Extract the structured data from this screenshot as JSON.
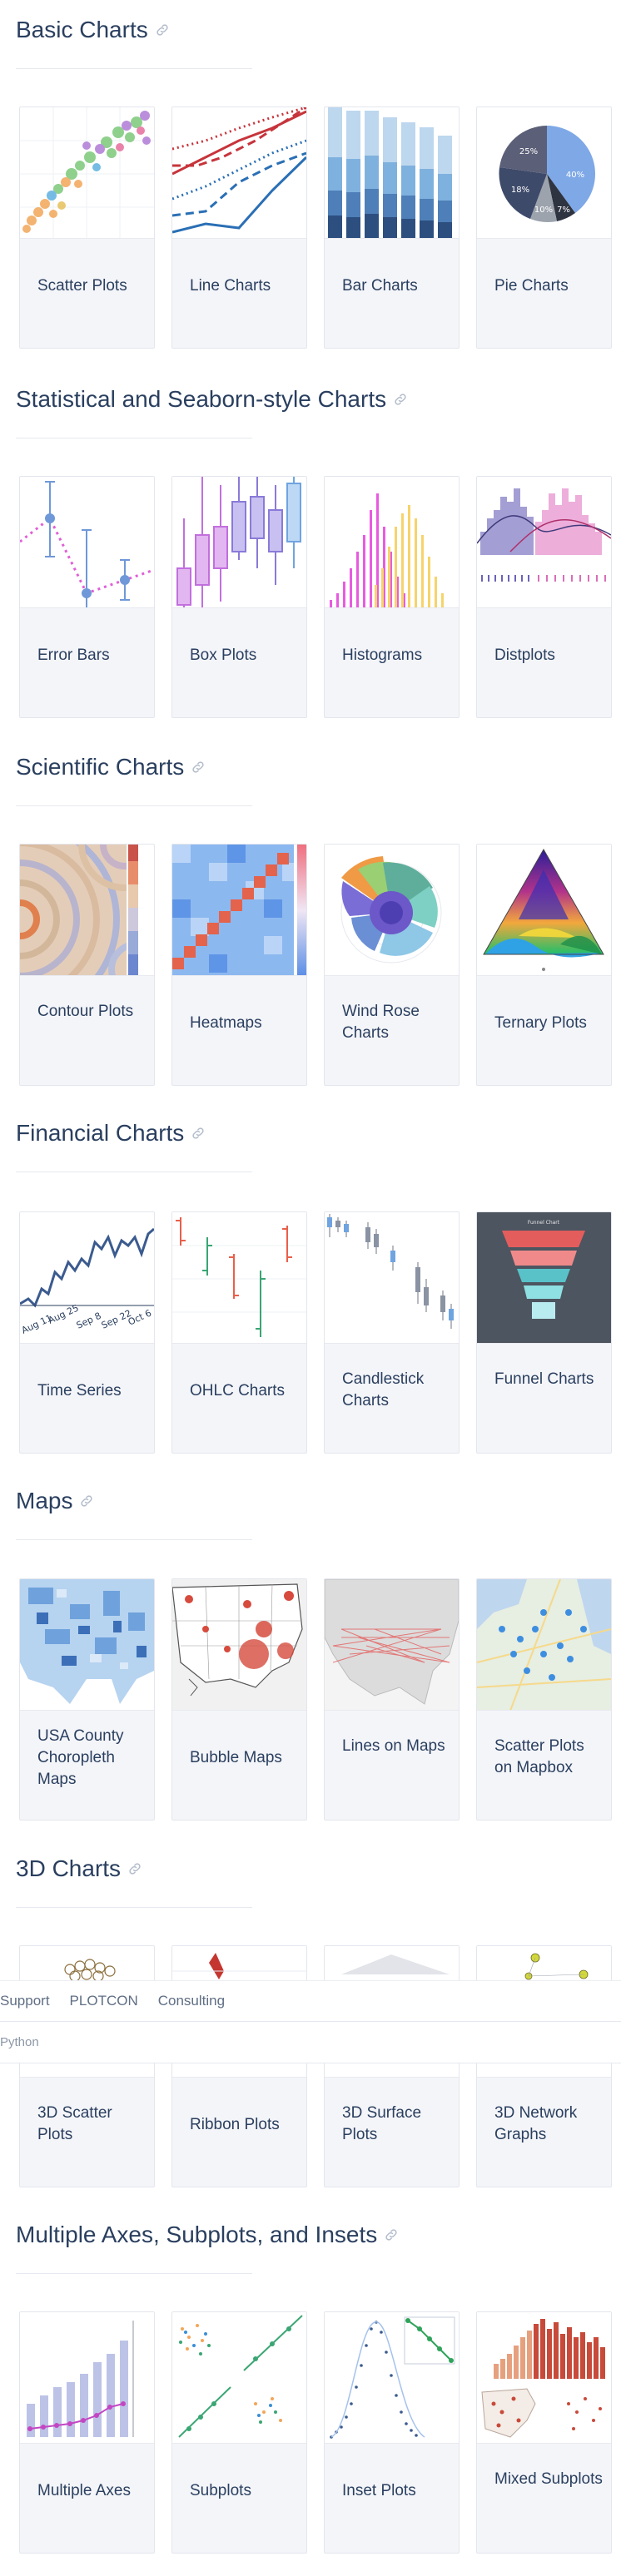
{
  "colors": {
    "text": "#2a3f5f",
    "card_bg": "#f4f5f9",
    "accent_blue": "#636efa",
    "accent_red": "#ef553b"
  },
  "sections": [
    {
      "title": "Basic Charts",
      "cards": [
        "Scatter Plots",
        "Line Charts",
        "Bar Charts",
        "Pie Charts"
      ]
    },
    {
      "title": "Statistical and Seaborn-style Charts",
      "cards": [
        "Error Bars",
        "Box Plots",
        "Histograms",
        "Distplots"
      ]
    },
    {
      "title": "Scientific Charts",
      "cards": [
        "Contour Plots",
        "Heatmaps",
        "Wind Rose Charts",
        "Ternary Plots"
      ]
    },
    {
      "title": "Financial Charts",
      "cards": [
        "Time Series",
        "OHLC Charts",
        "Candlestick Charts",
        "Funnel Charts"
      ]
    },
    {
      "title": "Maps",
      "cards": [
        "USA County Choropleth Maps",
        "Bubble Maps",
        "Lines on Maps",
        "Scatter Plots on Mapbox"
      ]
    },
    {
      "title": "3D Charts",
      "cards": [
        "3D Scatter Plots",
        "Ribbon Plots",
        "3D Surface Plots",
        "3D Network Graphs"
      ]
    },
    {
      "title": "Multiple Axes, Subplots, and Insets",
      "cards": [
        "Multiple Axes",
        "Subplots",
        "Inset Plots",
        "Mixed Subplots"
      ]
    }
  ],
  "thumbs": {
    "pie_labels": [
      "25%",
      "40%",
      "18%",
      "10%",
      "7%"
    ],
    "timeseries_ticks": [
      "Aug 11",
      "Aug 25",
      "Sep 8",
      "Sep 22",
      "Oct 6"
    ],
    "funnel_title": "Funnel Chart"
  },
  "topnav": {
    "items": [
      "Support",
      "PLOTCON",
      "Consulting"
    ],
    "sub": "Python"
  }
}
